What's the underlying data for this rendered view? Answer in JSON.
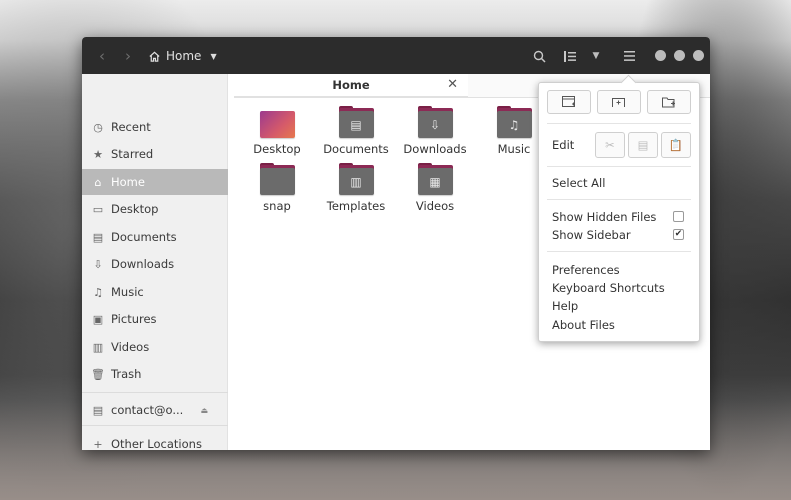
{
  "window": {
    "path_label": "Home",
    "tab_title": "Home"
  },
  "sidebar": {
    "items": [
      {
        "label": "Recent",
        "icon": "clock-icon"
      },
      {
        "label": "Starred",
        "icon": "star-icon"
      },
      {
        "label": "Home",
        "icon": "home-icon",
        "active": true
      },
      {
        "label": "Desktop",
        "icon": "desktop-icon"
      },
      {
        "label": "Documents",
        "icon": "document-icon"
      },
      {
        "label": "Downloads",
        "icon": "download-icon"
      },
      {
        "label": "Music",
        "icon": "music-icon"
      },
      {
        "label": "Pictures",
        "icon": "picture-icon"
      },
      {
        "label": "Videos",
        "icon": "video-icon"
      },
      {
        "label": "Trash",
        "icon": "trash-icon"
      }
    ],
    "mount": {
      "label": "contact@o...",
      "icon": "drive-icon"
    },
    "other": {
      "label": "Other Locations",
      "icon": "plus-icon"
    }
  },
  "files": [
    {
      "name": "Desktop",
      "icon": "desktop-folder-icon"
    },
    {
      "name": "Documents",
      "icon": "documents-folder-icon"
    },
    {
      "name": "Downloads",
      "icon": "downloads-folder-icon"
    },
    {
      "name": "Music",
      "icon": "music-folder-icon"
    },
    {
      "name": "snap",
      "icon": "folder-icon"
    },
    {
      "name": "Templates",
      "icon": "templates-folder-icon"
    },
    {
      "name": "Videos",
      "icon": "videos-folder-icon"
    }
  ],
  "menu": {
    "edit_label": "Edit",
    "select_all": "Select All",
    "show_hidden_files": "Show Hidden Files",
    "show_hidden_checked": false,
    "show_sidebar": "Show Sidebar",
    "show_sidebar_checked": true,
    "preferences": "Preferences",
    "keyboard_shortcuts": "Keyboard Shortcuts",
    "help": "Help",
    "about": "About Files"
  }
}
